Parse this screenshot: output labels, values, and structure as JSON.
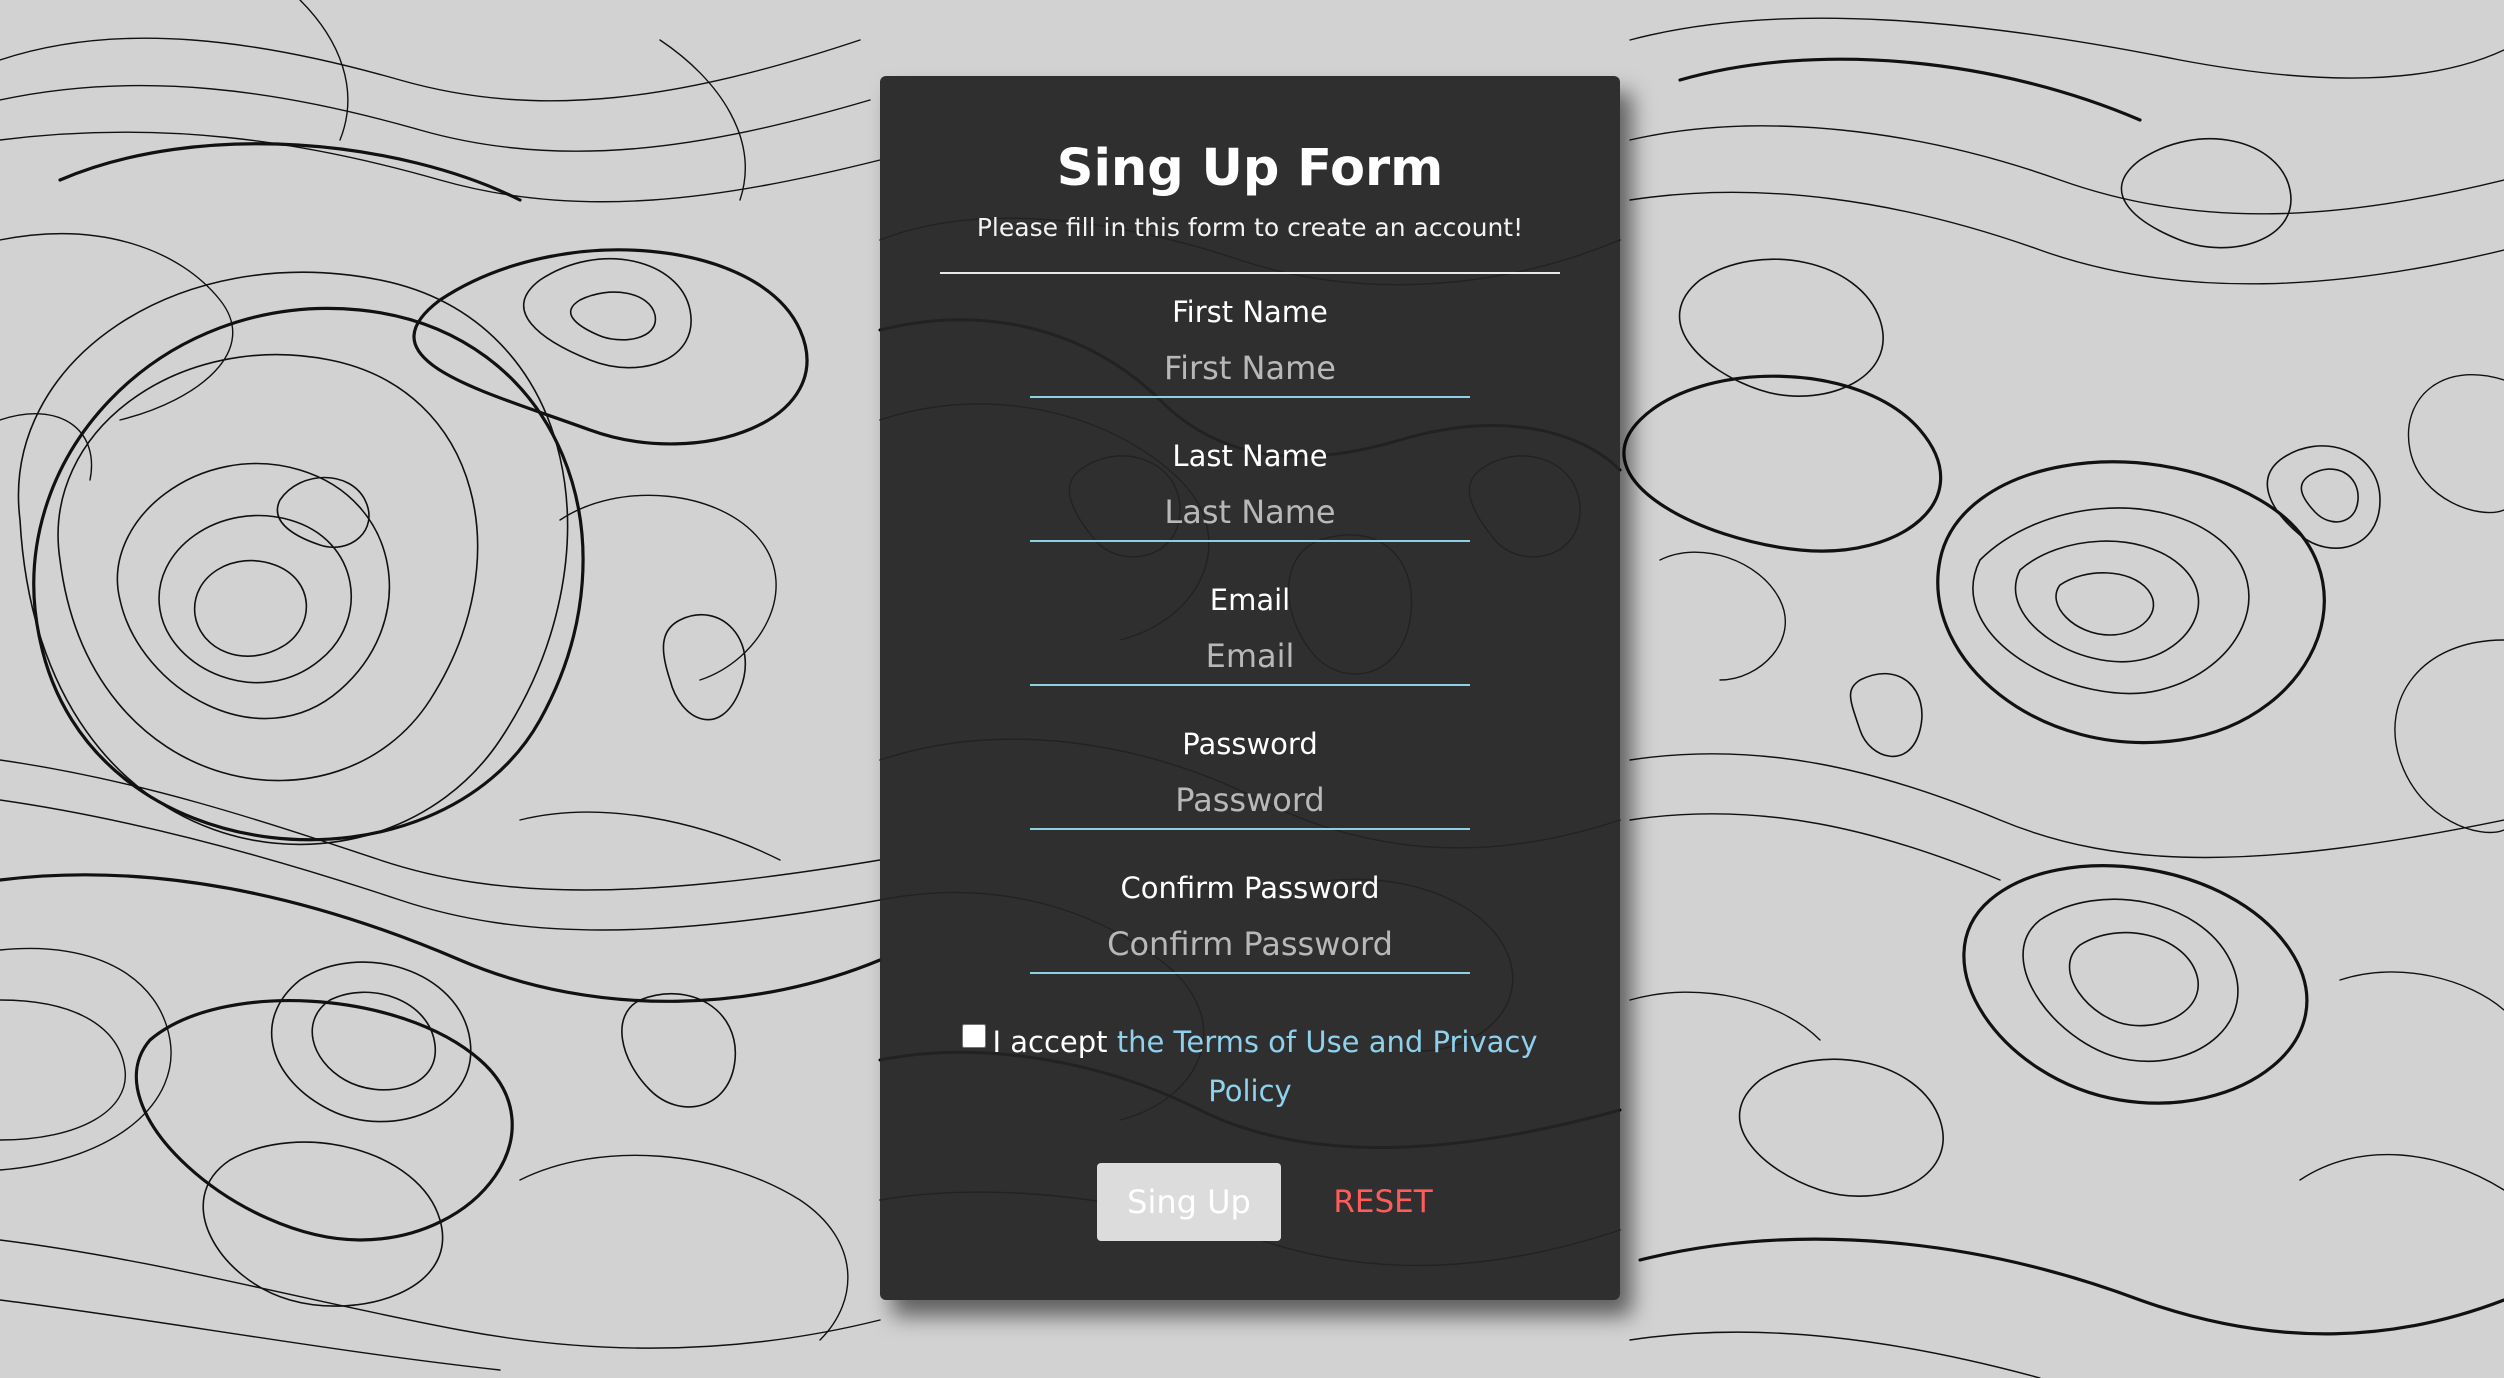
{
  "form": {
    "title": "Sing Up Form",
    "subtitle": "Please fill in this form to create an account!",
    "fields": [
      {
        "label": "First Name",
        "placeholder": "First Name"
      },
      {
        "label": "Last Name",
        "placeholder": "Last Name"
      },
      {
        "label": "Email",
        "placeholder": "Email"
      },
      {
        "label": "Password",
        "placeholder": "Password"
      },
      {
        "label": "Confirm Password",
        "placeholder": "Confirm Password"
      }
    ],
    "terms": {
      "prefix": "I accept",
      "link_text": "the Terms of Use and Privacy Policy",
      "checked": false
    },
    "buttons": {
      "signup": "Sing Up",
      "reset": "RESET"
    }
  },
  "colors": {
    "accent": "#8ecfe6",
    "link": "#8fd1ec",
    "reset": "#ff5b5b",
    "card": "#242424",
    "background": "#d2d2d2"
  }
}
